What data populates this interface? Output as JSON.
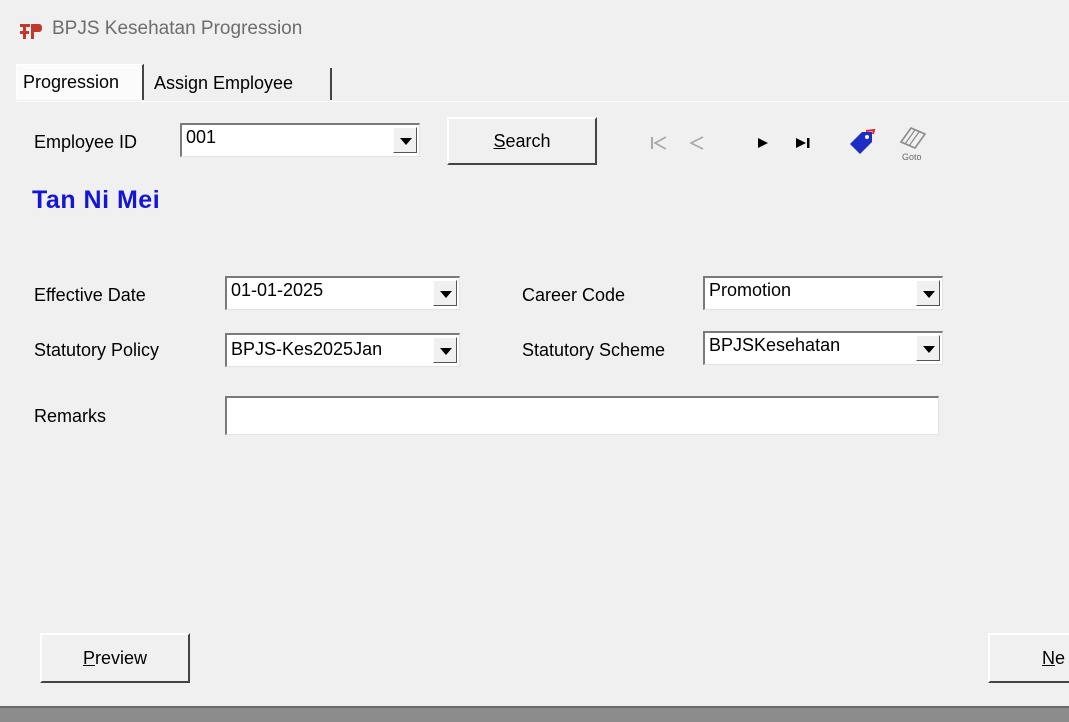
{
  "window": {
    "title": "BPJS Kesehatan Progression"
  },
  "tabs": [
    {
      "label": "Progression"
    },
    {
      "label": "Assign Employee"
    }
  ],
  "employee": {
    "id_label": "Employee ID",
    "id_value": "001",
    "search_label": "Search",
    "name": "Tan Ni Mei"
  },
  "navigation": {
    "icons": [
      "first-record-icon",
      "previous-record-icon",
      "next-record-icon",
      "last-record-icon",
      "bookmark-tag-icon",
      "goto-icon"
    ],
    "goto_caption": "Goto"
  },
  "form": {
    "effective_date_label": "Effective Date",
    "effective_date_value": "01-01-2025",
    "career_code_label": "Career Code",
    "career_code_value": "Promotion",
    "statutory_policy_label": "Statutory Policy",
    "statutory_policy_value": "BPJS-Kes2025Jan",
    "statutory_scheme_label": "Statutory Scheme",
    "statutory_scheme_value": "BPJSKesehatan",
    "remarks_label": "Remarks",
    "remarks_value": ""
  },
  "buttons": {
    "preview_label": "Preview",
    "next_label": "Ne"
  },
  "colors": {
    "employee_name": "#1515d8",
    "background": "#f0f0f0",
    "status_bar": "#8c8c8c"
  }
}
